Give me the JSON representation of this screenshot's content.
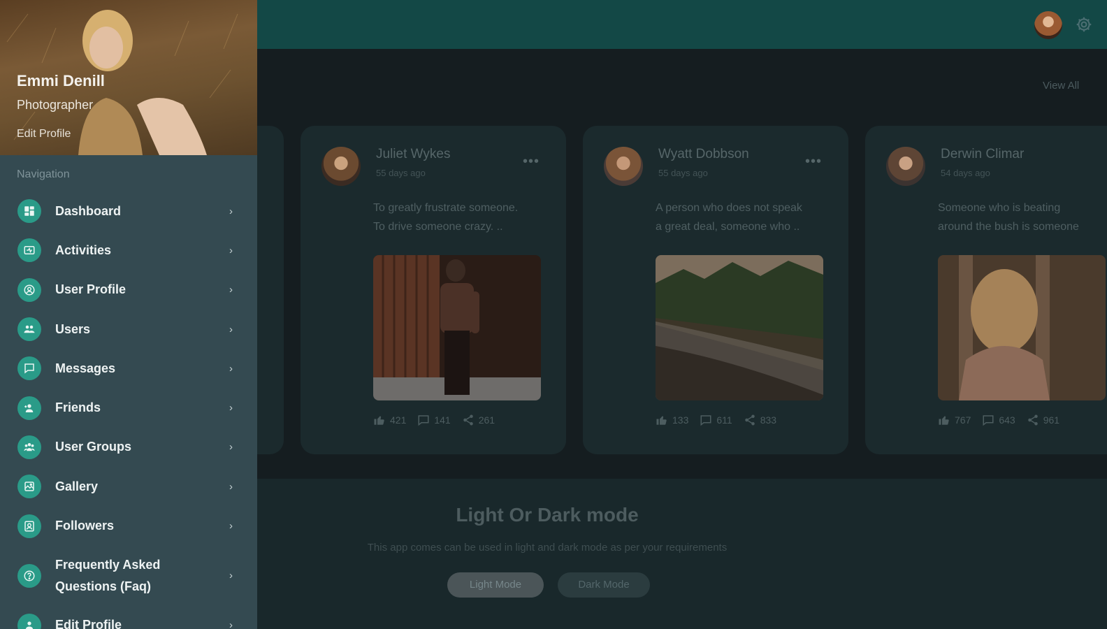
{
  "header": {
    "avatar": "user-avatar",
    "settings_icon": "gear-icon"
  },
  "profile": {
    "name": "Emmi Denill",
    "role": "Photographer",
    "edit_link": "Edit Profile"
  },
  "navigation": {
    "title": "Navigation",
    "items": [
      {
        "label": "Dashboard",
        "icon": "dashboard-icon"
      },
      {
        "label": "Activities",
        "icon": "activities-icon"
      },
      {
        "label": "User Profile",
        "icon": "user-profile-icon"
      },
      {
        "label": "Users",
        "icon": "users-icon"
      },
      {
        "label": "Messages",
        "icon": "messages-icon"
      },
      {
        "label": "Friends",
        "icon": "friends-icon"
      },
      {
        "label": "User Groups",
        "icon": "user-groups-icon"
      },
      {
        "label": "Gallery",
        "icon": "gallery-icon"
      },
      {
        "label": "Followers",
        "icon": "followers-icon"
      },
      {
        "label": "Frequently Asked\nQuestions (Faq)",
        "icon": "faq-icon"
      },
      {
        "label": "Edit Profile",
        "icon": "edit-profile-icon"
      }
    ]
  },
  "feed": {
    "view_all": "View All",
    "posts": [
      {
        "author": "Juliet Wykes",
        "time": "55 days ago",
        "text": "To greatly frustrate someone.\nTo drive someone crazy. ..",
        "likes": "421",
        "comments": "141",
        "shares": "261"
      },
      {
        "author": "Wyatt Dobbson",
        "time": "55 days ago",
        "text": "A person who does not speak\na great deal, someone who ..",
        "likes": "133",
        "comments": "611",
        "shares": "833"
      },
      {
        "author": "Derwin Climar",
        "time": "54 days ago",
        "text": "Someone who is beating\naround the bush is someone",
        "likes": "767",
        "comments": "643",
        "shares": "961"
      }
    ]
  },
  "mode": {
    "title": "Light Or Dark mode",
    "description": "This app comes can be used in light and dark mode as per your requirements",
    "light_button": "Light Mode",
    "dark_button": "Dark Mode"
  },
  "colors": {
    "header": "#134846",
    "sidebar": "#344a51",
    "accent": "#2a9b88",
    "card": "#1b2a2d"
  }
}
